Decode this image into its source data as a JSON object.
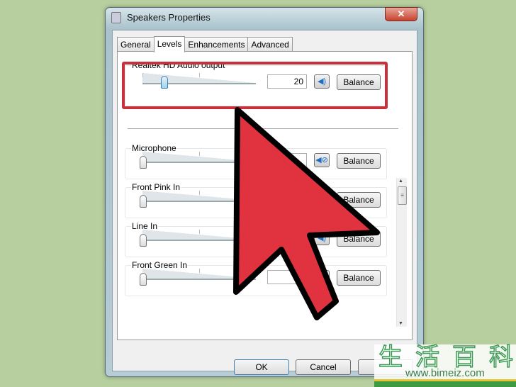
{
  "window": {
    "title": "Speakers Properties",
    "close_icon": "close-icon"
  },
  "tabs": [
    {
      "label": "General"
    },
    {
      "label": "Levels",
      "active": true
    },
    {
      "label": "Enhancements"
    },
    {
      "label": "Advanced"
    }
  ],
  "output": {
    "label": "Realtek HD Audio output",
    "value": "20",
    "level_percent": 20,
    "muted": false,
    "balance_label": "Balance"
  },
  "inputs": [
    {
      "label": "Microphone",
      "muted": true,
      "balance_label": "Balance"
    },
    {
      "label": "Front Pink In",
      "balance_label": "Balance"
    },
    {
      "label": "Line In",
      "balance_label": "Balance"
    },
    {
      "label": "Front Green In",
      "balance_label": "Balance"
    }
  ],
  "buttons": {
    "ok": "OK",
    "cancel": "Cancel"
  },
  "annotation": {
    "highlight_color": "#c8303c",
    "arrow_color": "#e0323f"
  },
  "watermark": {
    "chinese": "生活百科",
    "url": "www.bimeiz.com"
  }
}
